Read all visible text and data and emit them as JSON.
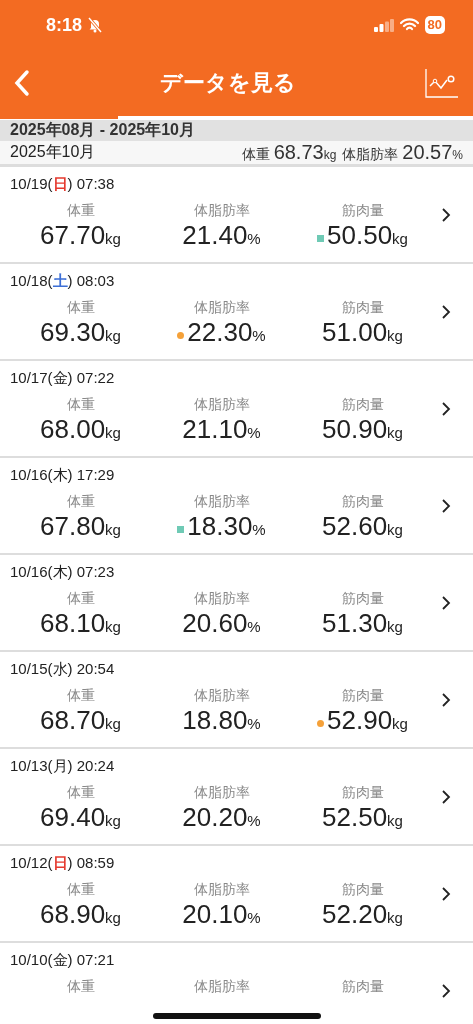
{
  "status_bar": {
    "time": "8:18",
    "battery": "80"
  },
  "nav": {
    "title": "データを見る",
    "progress": {
      "level": 0.25
    }
  },
  "range": {
    "title": "2025年08月 - 2025年10月"
  },
  "month": {
    "label": "2025年10月",
    "stats": [
      {
        "label": "体重",
        "value": "68.73",
        "unit": "kg"
      },
      {
        "label": "体脂肪率",
        "value": "20.57",
        "unit": "%"
      }
    ]
  },
  "entries": [
    {
      "date": "10/19(",
      "weekday": {
        "text": "日",
        "color": "#e53a2f"
      },
      "time": ") 07:38",
      "values": [
        {
          "label": "体重",
          "value": "67.70",
          "unit": "kg"
        },
        {
          "label": "体脂肪率",
          "value": "21.40",
          "unit": "%"
        },
        {
          "label": "筋肉量",
          "value": "50.50",
          "unit": "kg",
          "marker": {
            "kind": "square",
            "color": "#6fcab5"
          }
        }
      ]
    },
    {
      "date": "10/18(",
      "weekday": {
        "text": "土",
        "color": "#3d6fd6"
      },
      "time": ") 08:03",
      "values": [
        {
          "label": "体重",
          "value": "69.30",
          "unit": "kg"
        },
        {
          "label": "体脂肪率",
          "value": "22.30",
          "unit": "%",
          "marker": {
            "kind": "circle",
            "color": "#f5a139"
          }
        },
        {
          "label": "筋肉量",
          "value": "51.00",
          "unit": "kg"
        }
      ]
    },
    {
      "date": "10/17(",
      "weekday": {
        "text": "金"
      },
      "time": ") 07:22",
      "values": [
        {
          "label": "体重",
          "value": "68.00",
          "unit": "kg"
        },
        {
          "label": "体脂肪率",
          "value": "21.10",
          "unit": "%"
        },
        {
          "label": "筋肉量",
          "value": "50.90",
          "unit": "kg"
        }
      ]
    },
    {
      "date": "10/16(",
      "weekday": {
        "text": "木"
      },
      "time": ") 17:29",
      "values": [
        {
          "label": "体重",
          "value": "67.80",
          "unit": "kg"
        },
        {
          "label": "体脂肪率",
          "value": "18.30",
          "unit": "%",
          "marker": {
            "kind": "square",
            "color": "#6fcab5"
          }
        },
        {
          "label": "筋肉量",
          "value": "52.60",
          "unit": "kg"
        }
      ]
    },
    {
      "date": "10/16(",
      "weekday": {
        "text": "木"
      },
      "time": ") 07:23",
      "values": [
        {
          "label": "体重",
          "value": "68.10",
          "unit": "kg"
        },
        {
          "label": "体脂肪率",
          "value": "20.60",
          "unit": "%"
        },
        {
          "label": "筋肉量",
          "value": "51.30",
          "unit": "kg"
        }
      ]
    },
    {
      "date": "10/15(",
      "weekday": {
        "text": "水"
      },
      "time": ") 20:54",
      "values": [
        {
          "label": "体重",
          "value": "68.70",
          "unit": "kg"
        },
        {
          "label": "体脂肪率",
          "value": "18.80",
          "unit": "%"
        },
        {
          "label": "筋肉量",
          "value": "52.90",
          "unit": "kg",
          "marker": {
            "kind": "circle",
            "color": "#f5a139"
          }
        }
      ]
    },
    {
      "date": "10/13(",
      "weekday": {
        "text": "月"
      },
      "time": ") 20:24",
      "values": [
        {
          "label": "体重",
          "value": "69.40",
          "unit": "kg"
        },
        {
          "label": "体脂肪率",
          "value": "20.20",
          "unit": "%"
        },
        {
          "label": "筋肉量",
          "value": "52.50",
          "unit": "kg"
        }
      ]
    },
    {
      "date": "10/12(",
      "weekday": {
        "text": "日",
        "color": "#e53a2f"
      },
      "time": ") 08:59",
      "values": [
        {
          "label": "体重",
          "value": "68.90",
          "unit": "kg"
        },
        {
          "label": "体脂肪率",
          "value": "20.10",
          "unit": "%"
        },
        {
          "label": "筋肉量",
          "value": "52.20",
          "unit": "kg"
        }
      ]
    },
    {
      "date": "10/10(",
      "weekday": {
        "text": "金"
      },
      "time": ") 07:21",
      "values": [
        {
          "label": "体重"
        },
        {
          "label": "体脂肪率"
        },
        {
          "label": "筋肉量"
        }
      ]
    }
  ]
}
